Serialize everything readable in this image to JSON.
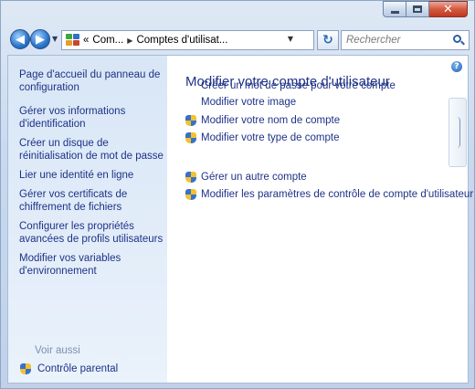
{
  "window": {
    "minimize": "minimize",
    "maximize": "maximize",
    "close": "close"
  },
  "nav": {
    "breadcrumb": [
      "Com...",
      "Comptes d'utilisat..."
    ],
    "breadcrumb_prefix": "«",
    "search_placeholder": "Rechercher"
  },
  "sidebar": {
    "links": [
      "Page d'accueil du panneau de configuration",
      "Gérer vos informations d'identification",
      "Créer un disque de réinitialisation de mot de passe",
      "Lier une identité en ligne",
      "Gérer vos certificats de chiffrement de fichiers",
      "Configurer les propriétés avancées de profils utilisateurs",
      "Modifier vos variables d'environnement"
    ],
    "see_also": "Voir aussi",
    "parental_control": "Contrôle parental"
  },
  "main": {
    "title": "Modifier votre compte d'utilisateur",
    "tasks": [
      "Créer un mot de passe pour votre compte",
      "Modifier votre image",
      "Modifier votre nom de compte",
      "Modifier votre type de compte"
    ],
    "other_tasks": [
      "Gérer un autre compte",
      "Modifier les paramètres de contrôle de compte d'utilisateur"
    ]
  },
  "colors": {
    "link": "#1e3287",
    "sidebar_bg": "#dce8f7",
    "see_also": "#7b8fb0"
  }
}
